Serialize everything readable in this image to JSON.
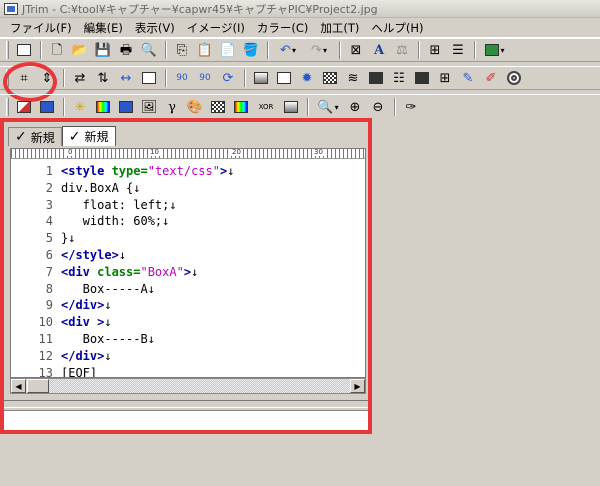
{
  "window": {
    "title": "JTrim - C:¥tool¥キャプチャー¥capwr45¥キャプチャPIC¥Project2.jpg"
  },
  "menu": [
    "ファイル(F)",
    "編集(E)",
    "表示(V)",
    "イメージ(I)",
    "カラー(C)",
    "加工(T)",
    "ヘルプ(H)"
  ],
  "toolbar_rotate": {
    "left": "90",
    "right": "90"
  },
  "toolbar_text_tool": "A",
  "toolbar_xor": "XOR",
  "tabs": [
    {
      "check": "✓",
      "label": "新規"
    },
    {
      "check": "✓",
      "label": "新規"
    }
  ],
  "ruler": {
    "marks": [
      "0",
      "10",
      "20",
      "30"
    ]
  },
  "code_lines": [
    {
      "num": "1",
      "text": "<style type=\"text/css\">↓"
    },
    {
      "num": "2",
      "text": "div.BoxA {↓"
    },
    {
      "num": "3",
      "text": "   float: left;↓"
    },
    {
      "num": "4",
      "text": "   width: 60%;↓"
    },
    {
      "num": "5",
      "text": "}↓"
    },
    {
      "num": "6",
      "text": "</style>↓"
    },
    {
      "num": "7",
      "text": "<div class=\"BoxA\">↓"
    },
    {
      "num": "8",
      "text": "   Box-----A↓"
    },
    {
      "num": "9",
      "text": "</div>↓"
    },
    {
      "num": "10",
      "text": "<div >↓"
    },
    {
      "num": "11",
      "text": "   Box-----B↓"
    },
    {
      "num": "12",
      "text": "</div>↓"
    },
    {
      "num": "13",
      "text": "[EOF]"
    }
  ],
  "colors": {
    "highlight": "#e8373b",
    "tag": "#0000a0",
    "attr": "#008000",
    "string": "#c000c0"
  }
}
